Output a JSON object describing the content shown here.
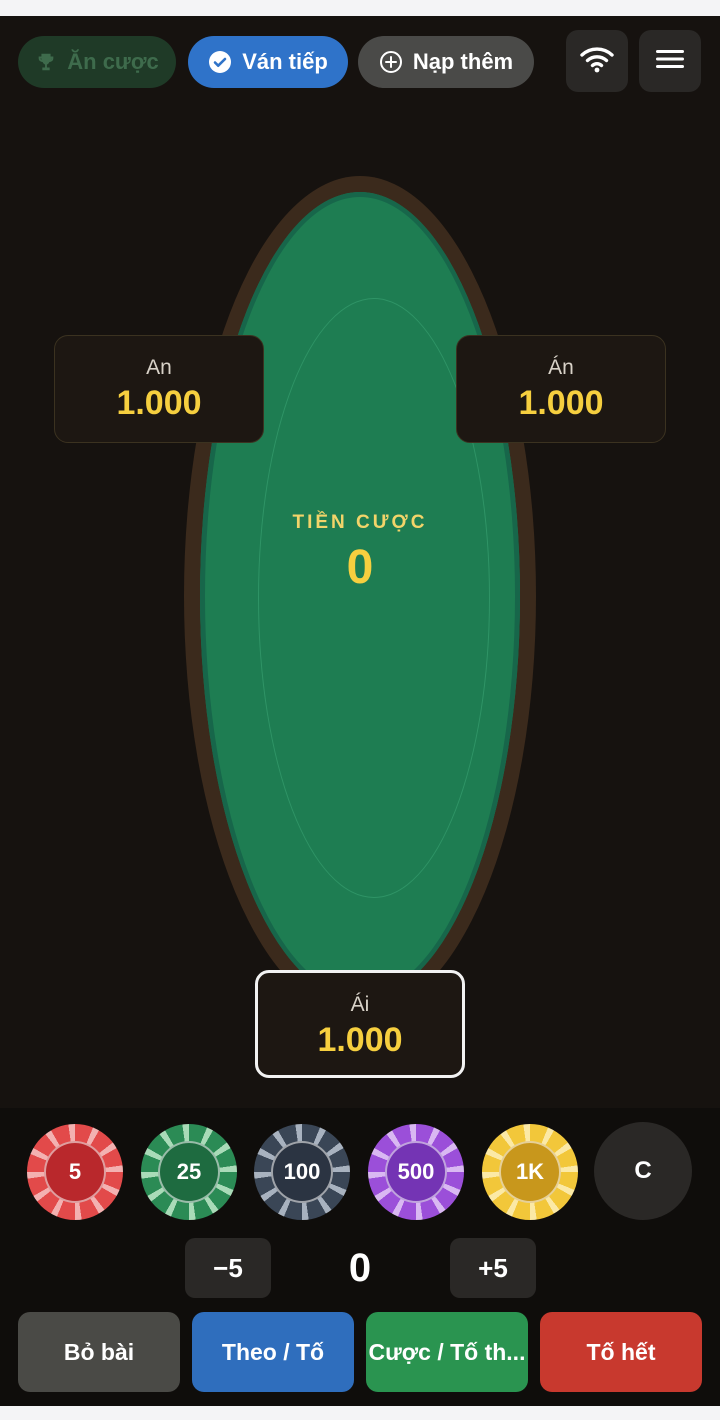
{
  "topbar": {
    "win_label": "Ăn cược",
    "next_label": "Ván tiếp",
    "topup_label": "Nạp thêm",
    "icons": [
      "trophy-icon",
      "check-circle-icon",
      "plus-circle-icon",
      "wifi-icon",
      "menu-icon"
    ]
  },
  "table": {
    "pot_label": "TIỀN CƯỢC",
    "pot_value": "0"
  },
  "players": {
    "left": {
      "name": "An",
      "chips": "1.000"
    },
    "right": {
      "name": "Án",
      "chips": "1.000"
    },
    "me": {
      "name": "Ái",
      "chips": "1.000"
    }
  },
  "chips": {
    "c5": "5",
    "c25": "25",
    "c100": "100",
    "c500": "500",
    "c1k": "1K",
    "clear": "C"
  },
  "stepper": {
    "minus": "−5",
    "amount": "0",
    "plus": "+5"
  },
  "actions": {
    "fold": "Bỏ bài",
    "call": "Theo / Tố",
    "bet": "Cược / Tố th...",
    "allin": "Tố hết"
  },
  "colors": {
    "felt": "#1e7d52",
    "accent_gold": "#f6cf3f",
    "next_blue": "#2f73c9",
    "allin_red": "#c8392e"
  }
}
